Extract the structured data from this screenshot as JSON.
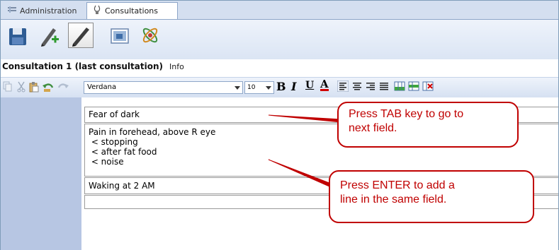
{
  "tabs": [
    {
      "label": "Administration",
      "icon": "admin-icon"
    },
    {
      "label": "Consultations",
      "icon": "consultations-icon",
      "active": true
    }
  ],
  "toolbar": {
    "buttons": [
      "save-icon",
      "new-consultation-icon",
      "edit-pen-icon",
      "image-icon",
      "remedy-icon"
    ],
    "selected": "edit-pen-icon"
  },
  "consultation": {
    "title": "Consultation 1 (last consultation)",
    "info_tab": "Info"
  },
  "format_toolbar": {
    "font_family": "Verdana",
    "font_size": "10",
    "bold": "B",
    "italic": "I",
    "underline": "U",
    "font_color": "A",
    "font_color_hex": "#d00000"
  },
  "fields": [
    {
      "lines": [
        "Fear of dark"
      ]
    },
    {
      "lines": [
        "Pain in forehead, above R eye",
        " < stopping",
        " < after fat food",
        " < noise"
      ]
    },
    {
      "lines": [
        "Waking at 2 AM"
      ]
    },
    {
      "lines": [
        ""
      ]
    }
  ],
  "callouts": {
    "tab": {
      "line1": "Press TAB key to go to",
      "line2": "next field."
    },
    "enter": {
      "line1": "Press ENTER to add a",
      "line2": "line in the same field."
    }
  },
  "colors": {
    "accent": "#c00000",
    "panel": "#b7c6e3",
    "toolbar": "#dbe5f4"
  }
}
